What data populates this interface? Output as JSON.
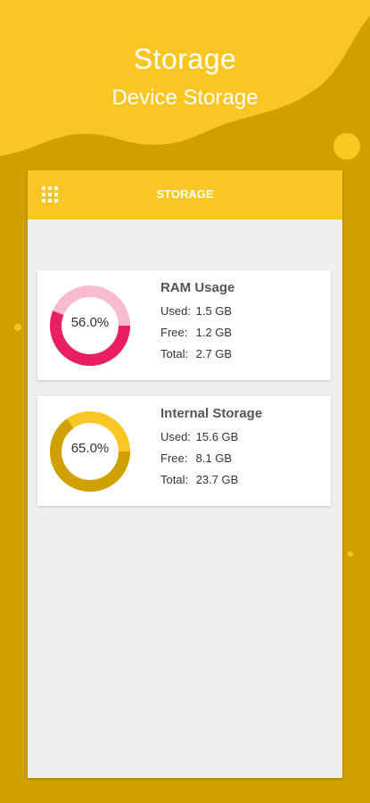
{
  "header": {
    "title": "Storage",
    "subtitle": "Device Storage"
  },
  "appbar": {
    "title": "STORAGE",
    "menu_icon": "grid-menu-icon"
  },
  "colors": {
    "background_dark": "#cfa000",
    "accent_yellow": "#f9c623",
    "ram_used": "#e91e63",
    "ram_free": "#f8bbd0",
    "storage_used": "#cfa000",
    "storage_free": "#f9c623"
  },
  "ram": {
    "title": "RAM Usage",
    "percent_label": "56.0%",
    "used_fraction": 0.56,
    "used_label": "Used:",
    "used_value": "1.5 GB",
    "free_label": "Free:",
    "free_value": "1.2 GB",
    "total_label": "Total:",
    "total_value": "2.7 GB"
  },
  "storage": {
    "title": "Internal Storage",
    "percent_label": "65.0%",
    "used_fraction": 0.65,
    "used_label": "Used:",
    "used_value": "15.6 GB",
    "free_label": "Free:",
    "free_value": "8.1 GB",
    "total_label": "Total:",
    "total_value": "23.7 GB"
  }
}
